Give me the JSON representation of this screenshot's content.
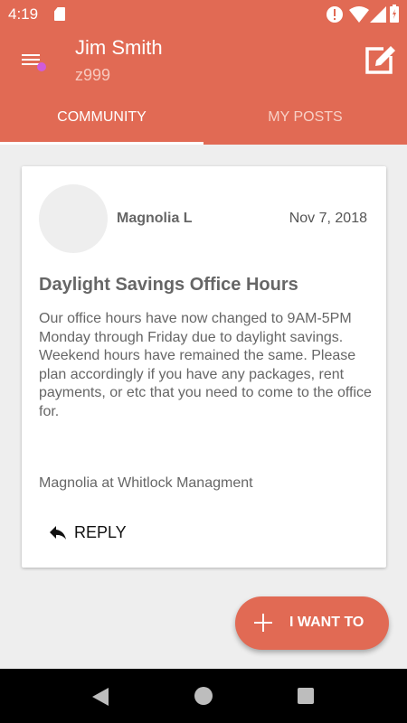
{
  "status_bar": {
    "time": "4:19",
    "icons": [
      "sd-card-icon",
      "alert-icon",
      "wifi-icon",
      "signal-icon",
      "battery-icon"
    ]
  },
  "header": {
    "user_name": "Jim Smith",
    "user_id": "z999",
    "menu_icon": "menu-icon",
    "compose_icon": "compose-icon"
  },
  "tabs": [
    {
      "label": "COMMUNITY",
      "selected": true
    },
    {
      "label": "MY POSTS",
      "selected": false
    }
  ],
  "post": {
    "author": "Magnolia L",
    "date": "Nov 7, 2018",
    "title": "Daylight Savings Office Hours",
    "body": "Our office hours have now changed to 9AM-5PM Monday through Friday due to daylight savings. Weekend hours have remained the same. Please plan accordingly if you have any packages, rent payments, or etc that you need to come to the office for.",
    "signature": "Magnolia at Whitlock Managment",
    "reply_label": "REPLY"
  },
  "fab": {
    "label": "I WANT TO",
    "icon": "plus-icon"
  },
  "nav": {
    "icons": [
      "back-icon",
      "home-icon",
      "recents-icon"
    ]
  },
  "colors": {
    "primary": "#e16a54",
    "avatar_notification": "#d05bd9",
    "background": "#eeeeee"
  }
}
